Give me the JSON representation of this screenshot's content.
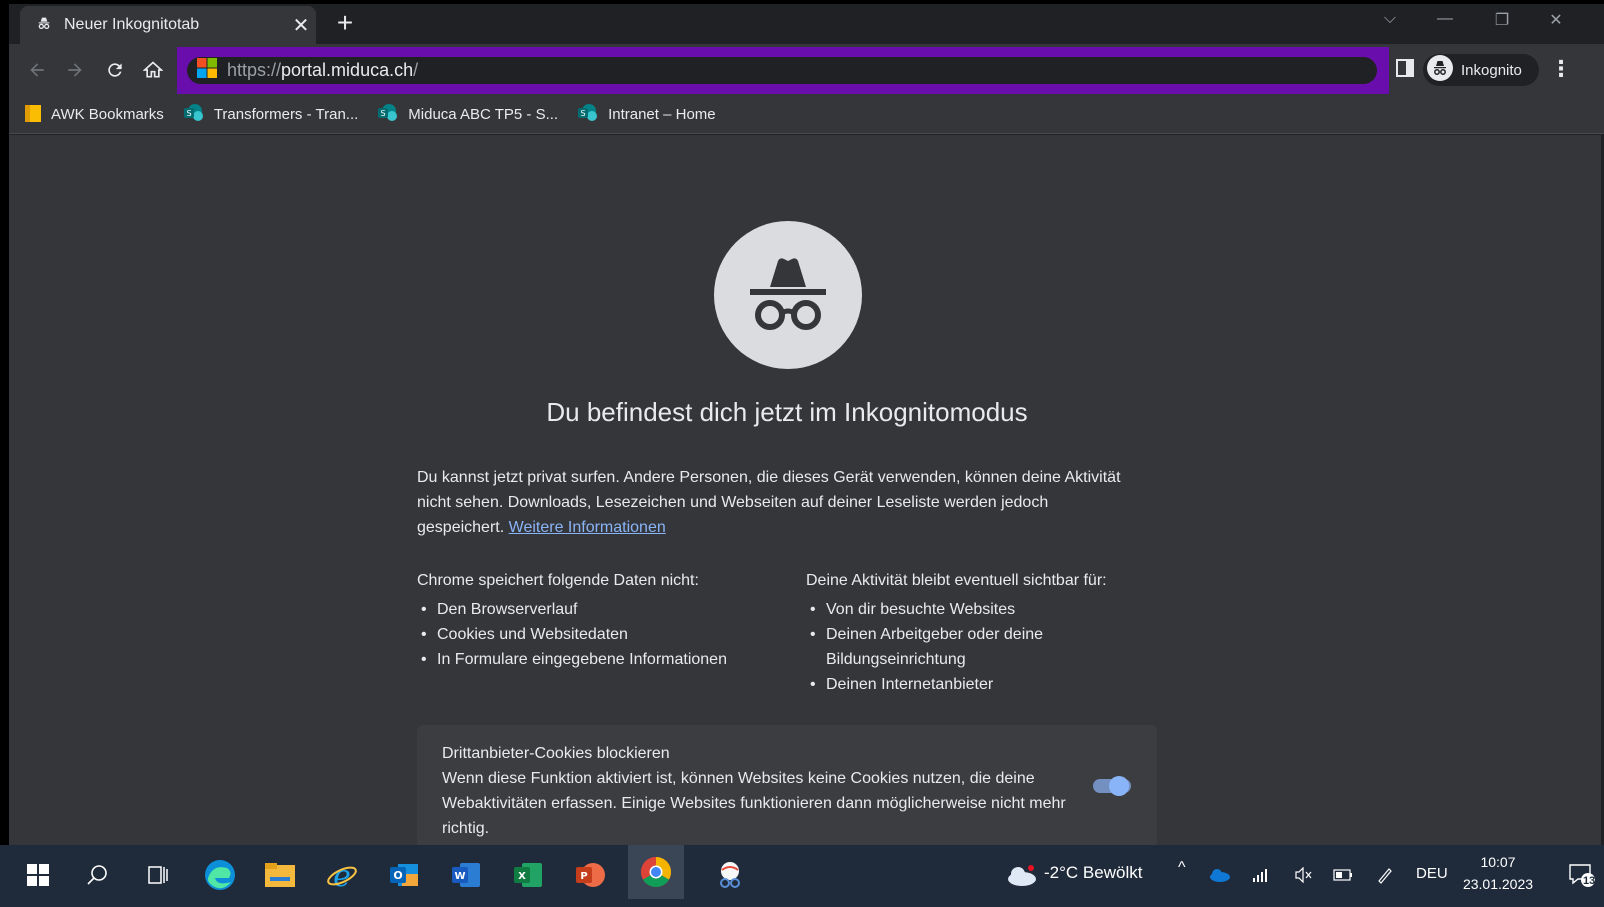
{
  "tab": {
    "title": "Neuer Inkognitotab",
    "close": "✕",
    "new_tab": "+"
  },
  "window_controls": {
    "dropdown": "⌵",
    "minimize": "—",
    "restore": "❐",
    "close": "✕"
  },
  "omnibox": {
    "scheme": "https://",
    "host": "portal.miduca.ch",
    "path": "/",
    "highlight_color": "#6a0dad"
  },
  "profile": {
    "label": "Inkognito"
  },
  "bookmarks": [
    {
      "label": "AWK Bookmarks",
      "icon": "folder-icon"
    },
    {
      "label": "Transformers - Tran...",
      "icon": "sharepoint-icon"
    },
    {
      "label": "Miduca ABC TP5 - S...",
      "icon": "sharepoint-icon"
    },
    {
      "label": "Intranet – Home",
      "icon": "sharepoint-icon"
    }
  ],
  "page": {
    "heading": "Du befindest dich jetzt im Inkognitomodus",
    "intro": "Du kannst jetzt privat surfen. Andere Personen, die dieses Gerät verwenden, können deine Aktivität nicht sehen. Downloads, Lesezeichen und Webseiten auf deiner Leseliste werden jedoch gespeichert.",
    "learn_more": "Weitere Informationen",
    "left_column": {
      "title": "Chrome speichert folgende Daten nicht:",
      "items": [
        "Den Browserverlauf",
        "Cookies und Websitedaten",
        "In Formulare eingegebene Informationen"
      ]
    },
    "right_column": {
      "title": "Deine Aktivität bleibt eventuell sichtbar für:",
      "items": [
        "Von dir besuchte Websites",
        "Deinen Arbeitgeber oder deine Bildungseinrichtung",
        "Deinen Internetanbieter"
      ]
    },
    "cookie_card": {
      "title": "Drittanbieter-Cookies blockieren",
      "text": "Wenn diese Funktion aktiviert ist, können Websites keine Cookies nutzen, die deine Webaktivitäten erfassen. Einige Websites funktionieren dann möglicherweise nicht mehr richtig.",
      "toggle_on": true
    }
  },
  "taskbar": {
    "weather": "-2°C  Bewölkt",
    "language": "DEU",
    "time": "10:07",
    "date": "23.01.2023",
    "notifications": "13"
  },
  "colors": {
    "accent": "#8ab4f8",
    "page_bg": "#35363a",
    "chrome_bg": "#202124"
  }
}
